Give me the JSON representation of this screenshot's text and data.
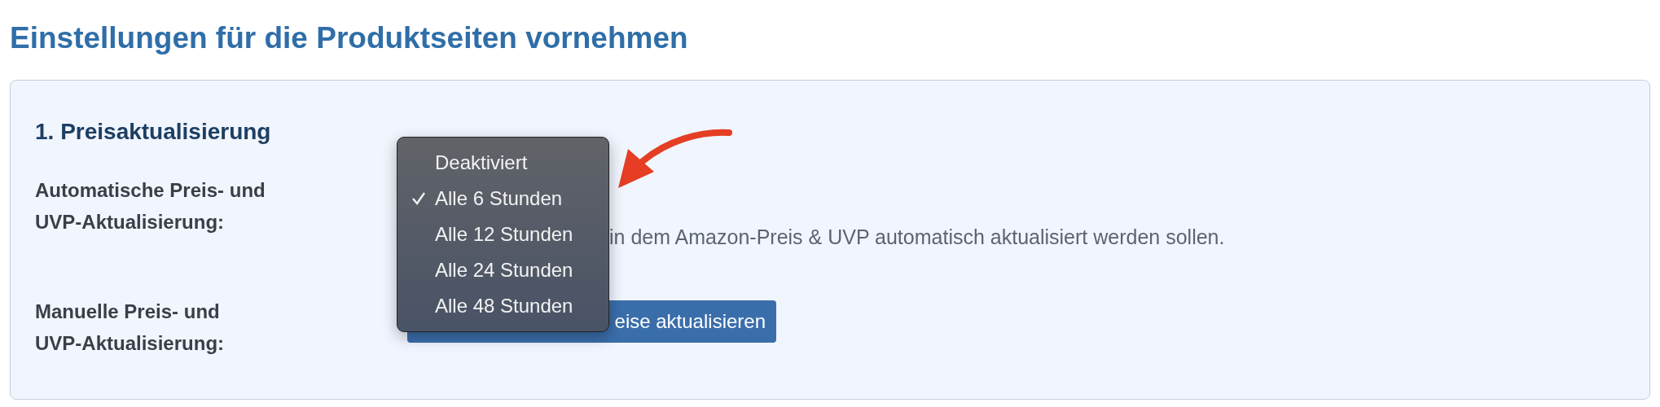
{
  "title": "Einstellungen für die Produktseiten vornehmen",
  "section": {
    "heading": "1. Preisaktualisierung",
    "rows": [
      {
        "kind": "select",
        "label": "Automatische Preis- und UVP-Aktualisierung:",
        "description": "in dem Amazon-Preis & UVP automatisch aktualisiert werden sollen."
      },
      {
        "kind": "button",
        "label": "Manuelle Preis- und UVP-Aktualisierung:",
        "button": "eise aktualisieren"
      }
    ]
  },
  "menu": {
    "options": [
      {
        "label": "Deaktiviert",
        "selected": false
      },
      {
        "label": "Alle 6 Stunden",
        "selected": true
      },
      {
        "label": "Alle 12 Stunden",
        "selected": false
      },
      {
        "label": "Alle 24 Stunden",
        "selected": false
      },
      {
        "label": "Alle 48 Stunden",
        "selected": false
      }
    ]
  }
}
